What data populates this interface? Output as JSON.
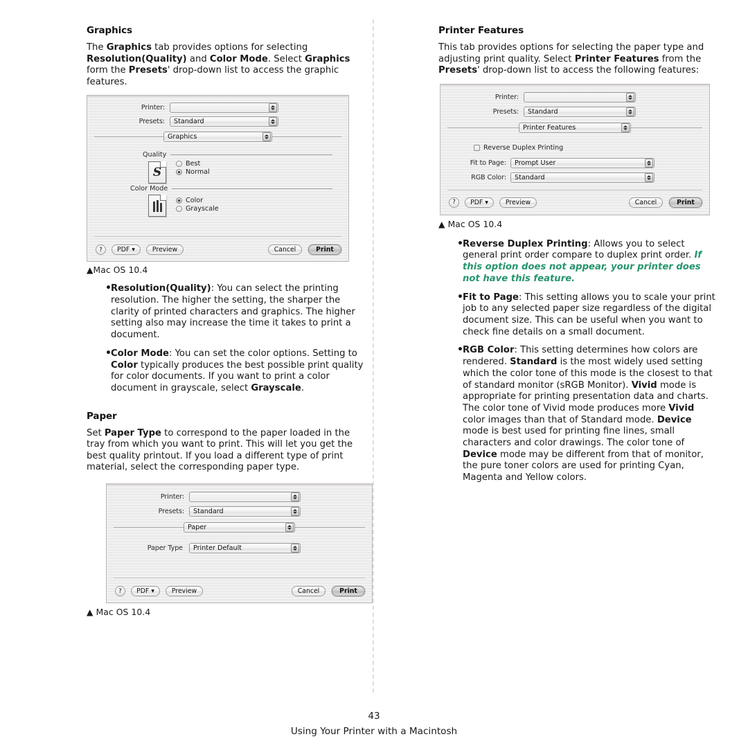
{
  "left_column": {
    "heading": "Graphics",
    "intro": {
      "t1": "The ",
      "b1": "Graphics",
      "t2": " tab provides options for selecting ",
      "b2": "Resolution(Quality)",
      "t3": " and ",
      "b3": "Color Mode",
      "t4": ". Select ",
      "b4": "Graphics",
      "t5": " form the ",
      "b5": "Presets",
      "t6": "' drop-down list to access the graphic features."
    },
    "graphics_dialog": {
      "printer_label": "Printer:",
      "printer_value": "",
      "presets_label": "Presets:",
      "presets_value": "Standard",
      "pane_value": "Graphics",
      "quality_group": "Quality",
      "quality_icon_letter": "S",
      "quality_options": [
        "Best",
        "Normal"
      ],
      "quality_selected": "Normal",
      "colormode_group": "Color Mode",
      "colormode_options": [
        "Color",
        "Grayscale"
      ],
      "colormode_selected": "Color",
      "help_label": "?",
      "pdf_label": "PDF ▾",
      "preview_label": "Preview",
      "cancel_label": "Cancel",
      "print_label": "Print"
    },
    "graphics_caption": "▲Mac OS 10.4",
    "bullets": [
      {
        "bold": "Resolution(Quality)",
        "text": ": You can select the printing resolution. The higher the setting, the sharper the clarity of printed characters and graphics. The higher setting also may increase the time it takes to print a document."
      },
      {
        "bold": "Color Mode",
        "text_a": ": You can set the color options. Setting to ",
        "bold_b": "Color",
        "text_b": " typically produces the best possible print quality for color documents. If you want to print a color document in grayscale, select ",
        "bold_c": "Grayscale",
        "text_c": "."
      }
    ],
    "paper_heading": "Paper",
    "paper_intro": {
      "t1": "Set ",
      "b1": "Paper Type",
      "t2": " to correspond to the paper loaded in the tray from which you want to print. This will let you get the best quality printout. If you load a different type of print material, select the corresponding paper type."
    },
    "paper_dialog": {
      "printer_label": "Printer:",
      "printer_value": "",
      "presets_label": "Presets:",
      "presets_value": "Standard",
      "pane_value": "Paper",
      "papertype_label": "Paper Type",
      "papertype_value": "Printer Default",
      "help_label": "?",
      "pdf_label": "PDF ▾",
      "preview_label": "Preview",
      "cancel_label": "Cancel",
      "print_label": "Print"
    },
    "paper_caption": "▲ Mac OS 10.4"
  },
  "right_column": {
    "heading": "Printer Features",
    "intro": {
      "t1": "This tab provides options for selecting the paper type and adjusting print quality. Select ",
      "b1": "Printer Features",
      "t2": " from the ",
      "b2": "Presets",
      "t3": "' drop-down list to access the following features:"
    },
    "features_dialog": {
      "printer_label": "Printer:",
      "printer_value": "",
      "presets_label": "Presets:",
      "presets_value": "Standard",
      "pane_value": "Printer Features",
      "reverse_duplex_label": "Reverse Duplex Printing",
      "reverse_duplex_checked": false,
      "fit_label": "Fit to Page:",
      "fit_value": "Prompt User",
      "rgb_label": "RGB Color:",
      "rgb_value": "Standard",
      "help_label": "?",
      "pdf_label": "PDF ▾",
      "preview_label": "Preview",
      "cancel_label": "Cancel",
      "print_label": "Print"
    },
    "features_caption": "▲ Mac OS 10.4",
    "bullets": [
      {
        "bold": "Reverse Duplex Printing",
        "text_a": ": Allows you to select general print order compare to duplex print order. ",
        "green": "If this option does not appear, your printer does not have this feature."
      },
      {
        "bold": "Fit to Page",
        "text_a": ": This setting allows you to scale your print job to any selected paper size regardless of the digital document size. This can be useful when you want to check fine details on a small document."
      },
      {
        "bold": "RGB Color",
        "p1": ": This setting determines how colors are rendered. ",
        "b1": "Standard",
        "p2": " is the most widely used setting which the color tone of this mode is the closest to that of standard monitor (sRGB Monitor). ",
        "b2": "Vivid",
        "p3": " mode is appropriate for printing presentation data and charts. The color tone of Vivid mode produces more ",
        "b3": "Vivid",
        "p4": " color images than that of Standard mode. ",
        "b4": "Device",
        "p5": " mode is best used for printing fine lines, small characters and color drawings. The color tone of ",
        "b5": "Device",
        "p6": " mode may be different from that of monitor, the pure toner colors are used for printing Cyan, Magenta and Yellow colors."
      }
    ]
  },
  "footer": {
    "page_number": "43",
    "title": "Using Your Printer with a Macintosh"
  },
  "colors": {
    "green_note": "#26956c",
    "divider": "#cfe4e0",
    "dialog_bg": "#f0f0f0"
  }
}
